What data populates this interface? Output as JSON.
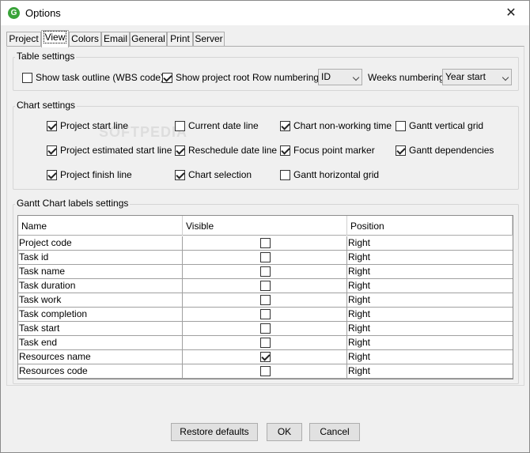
{
  "window": {
    "title": "Options",
    "app_icon_glyph": "G",
    "close_glyph": "✕",
    "accent_color": "#39a339"
  },
  "tabs": [
    {
      "label": "Project",
      "active": false
    },
    {
      "label": "View",
      "active": true
    },
    {
      "label": "Colors",
      "active": false
    },
    {
      "label": "Email",
      "active": false
    },
    {
      "label": "General",
      "active": false
    },
    {
      "label": "Print",
      "active": false
    },
    {
      "label": "Server",
      "active": false
    }
  ],
  "table_settings": {
    "title": "Table settings",
    "show_task_outline": {
      "label": "Show task outline (WBS code)",
      "checked": false
    },
    "show_project_root": {
      "label": "Show project root",
      "checked": true
    },
    "row_numbering_label": "Row numbering",
    "row_numbering_value": "ID",
    "weeks_numbering_label": "Weeks numbering",
    "weeks_numbering_value": "Year start",
    "watermark": "SOFTPEDIA"
  },
  "chart_settings": {
    "title": "Chart settings",
    "options": [
      {
        "label": "Project start line",
        "checked": true
      },
      {
        "label": "Current date line",
        "checked": false
      },
      {
        "label": "Chart non-working time",
        "checked": true
      },
      {
        "label": "Gantt vertical grid",
        "checked": false
      },
      {
        "label": "Project estimated start line",
        "checked": true
      },
      {
        "label": "Reschedule date line",
        "checked": true
      },
      {
        "label": "Focus point marker",
        "checked": true
      },
      {
        "label": "Gantt dependencies",
        "checked": true
      },
      {
        "label": "Project finish line",
        "checked": true
      },
      {
        "label": "Chart selection",
        "checked": true
      },
      {
        "label": "Gantt horizontal grid",
        "checked": false
      }
    ]
  },
  "labels_settings": {
    "title": "Gantt Chart labels settings",
    "columns": [
      "Name",
      "Visible",
      "Position"
    ],
    "rows": [
      {
        "name": "Project code",
        "visible": false,
        "position": "Right"
      },
      {
        "name": "Task id",
        "visible": false,
        "position": "Right"
      },
      {
        "name": "Task name",
        "visible": false,
        "position": "Right"
      },
      {
        "name": "Task duration",
        "visible": false,
        "position": "Right"
      },
      {
        "name": "Task work",
        "visible": false,
        "position": "Right"
      },
      {
        "name": "Task completion",
        "visible": false,
        "position": "Right"
      },
      {
        "name": "Task start",
        "visible": false,
        "position": "Right"
      },
      {
        "name": "Task end",
        "visible": false,
        "position": "Right"
      },
      {
        "name": "Resources name",
        "visible": true,
        "position": "Right"
      },
      {
        "name": "Resources code",
        "visible": false,
        "position": "Right"
      }
    ]
  },
  "buttons": {
    "restore_defaults": "Restore defaults",
    "ok": "OK",
    "cancel": "Cancel"
  }
}
